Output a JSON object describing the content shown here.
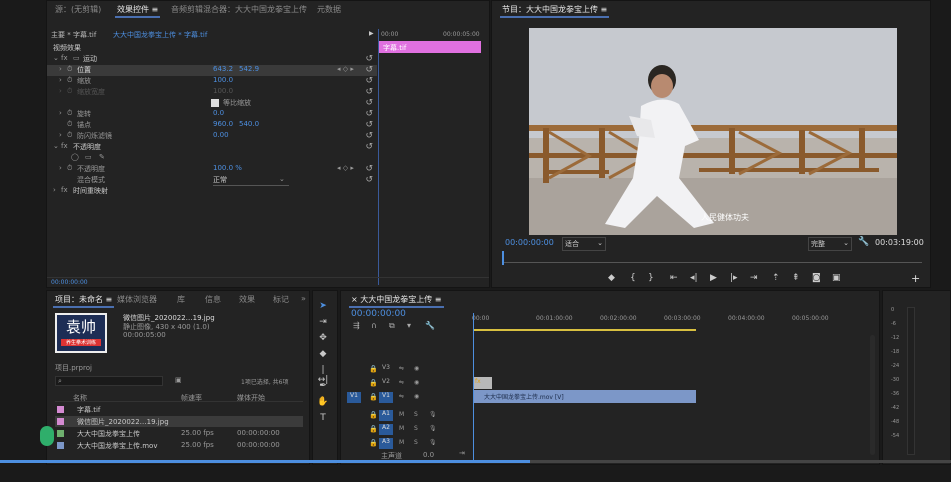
{
  "top_tabs": {
    "source": "源：(无剪辑)",
    "effect_controls": "效果控件",
    "audio_mixer": "音频剪辑混合器：大大中国龙拳宝上传",
    "metadata": "元数据",
    "menu": "≡"
  },
  "effect_controls": {
    "master": "主要 * 字幕.tif",
    "clip": "大大中国龙拳宝上传 * 字幕.tif",
    "timecode_start": "00:00",
    "timecode_end": "00:00:05:00",
    "clip_bar_label": "字幕.tif",
    "video_effects": "视频效果",
    "motion": "运动",
    "position": {
      "label": "位置",
      "x": "643.2",
      "y": "542.9"
    },
    "scale": {
      "label": "缩放",
      "value": "100.0"
    },
    "scale_width": {
      "label": "缩放宽度",
      "value": "100.0"
    },
    "uniform_scale": "等比缩放",
    "rotation": {
      "label": "旋转",
      "value": "0.0"
    },
    "anchor": {
      "label": "锚点",
      "x": "960.0",
      "y": "540.0"
    },
    "anti_flicker": {
      "label": "防闪烁滤镜",
      "value": "0.00"
    },
    "opacity_section": "不透明度",
    "opacity": {
      "label": "不透明度",
      "value": "100.0 %"
    },
    "blend_mode": {
      "label": "混合模式",
      "value": "正常"
    },
    "time_remap": "时间重映射",
    "bottom_tc": "00:00:00:00"
  },
  "program": {
    "title": "节目：大大中国龙拳宝上传",
    "menu": "≡",
    "timecode": "00:00:00:00",
    "fit": "适合",
    "quality": "完整",
    "duration": "00:03:19:00",
    "watermark": "人民健体功夫"
  },
  "project": {
    "tabs": [
      "项目：未命名",
      "媒体浏览器",
      "库",
      "信息",
      "效果",
      "标记"
    ],
    "more": "»",
    "thumb_text": "袁帅",
    "thumb_sub": "养生拳术训练",
    "file_name": "微信图片_2020022…19.jpg",
    "file_info1": "静止图像, 430 x 400 (1.0)",
    "file_info2": "00:00:05:00",
    "path": "项目.prproj",
    "count": "1项已选择, 共6项",
    "col_name": "名称",
    "col_fps": "帧速率",
    "col_start": "媒体开始",
    "items": [
      {
        "name": "字幕.tif",
        "fps": "",
        "start": "",
        "color": "#d48ad2"
      },
      {
        "name": "微信图片_2020022…19.jpg",
        "fps": "",
        "start": "",
        "color": "#d48ad2"
      },
      {
        "name": "大大中国龙拳宝上传",
        "fps": "25.00 fps",
        "start": "00:00:00:00",
        "color": "#6fb06f"
      },
      {
        "name": "大大中国龙拳宝上传.mov",
        "fps": "25.00 fps",
        "start": "00:00:00:00",
        "color": "#7c97c8"
      }
    ]
  },
  "timeline": {
    "close": "×",
    "title": "大大中国龙拳宝上传",
    "menu": "≡",
    "timecode": "00:00:00:00",
    "ruler": [
      "00:00",
      "00:01:00:00",
      "00:02:00:00",
      "00:03:00:00",
      "00:04:00:00",
      "00:05:00:00"
    ],
    "tracks_video": [
      "V3",
      "V2",
      "V1"
    ],
    "tracks_audio": [
      "A1",
      "A2",
      "A3"
    ],
    "master": "主声道",
    "master_val": "0.0",
    "v1_src": "V1",
    "clip_v1": "大大中国龙拳宝上传.mov [V]",
    "clip_v2": "fx"
  },
  "meter": {
    "labels": [
      "0",
      "-6",
      "-12",
      "-18",
      "-24",
      "-30",
      "-36",
      "-42",
      "-48",
      "-54"
    ]
  },
  "colors": {
    "accent": "#4d8fe0",
    "pink": "#e070e0",
    "clip_blue": "#7c97c8",
    "yellow": "#d8c040"
  }
}
